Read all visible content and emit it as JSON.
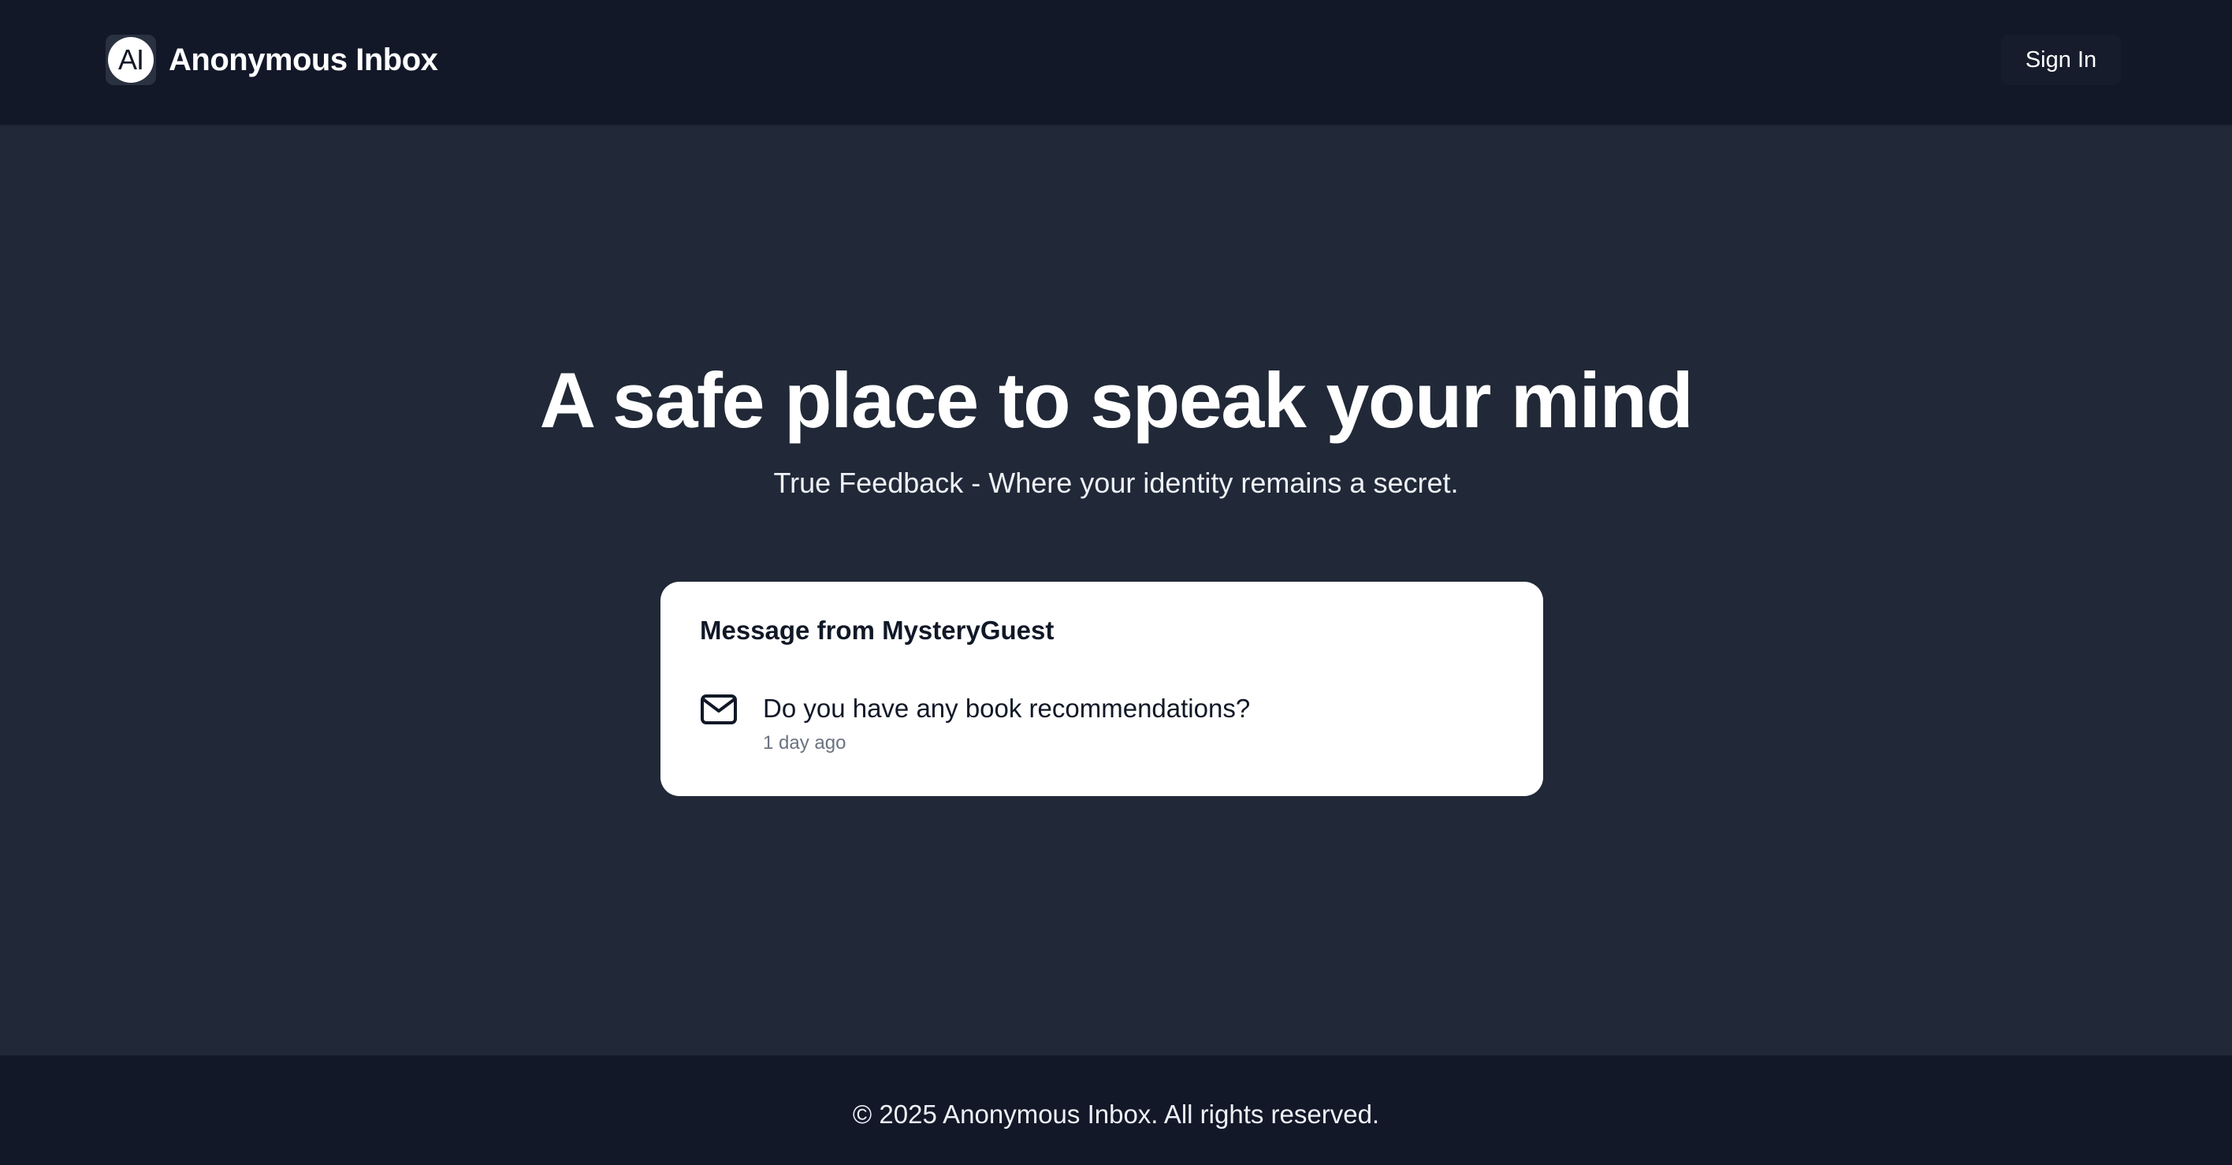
{
  "header": {
    "logo_text": "AI",
    "brand_name": "Anonymous Inbox",
    "signin_label": "Sign In"
  },
  "hero": {
    "title": "A safe place to speak your mind",
    "subtitle": "True Feedback - Where your identity remains a secret."
  },
  "message_card": {
    "title": "Message from MysteryGuest",
    "icon": "mail-icon",
    "content": "Do you have any book recommendations?",
    "time": "1 day ago"
  },
  "footer": {
    "text": "© 2025 Anonymous Inbox. All rights reserved."
  },
  "colors": {
    "background": "#212938",
    "header_background": "#131829",
    "card_background": "#ffffff",
    "muted_text": "#6b7280"
  }
}
